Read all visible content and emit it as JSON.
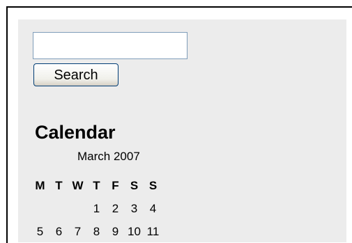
{
  "search": {
    "value": "",
    "button_label": "Search"
  },
  "calendar": {
    "title": "Calendar",
    "caption": "March 2007",
    "weekdays": [
      "M",
      "T",
      "W",
      "T",
      "F",
      "S",
      "S"
    ],
    "weeks": [
      [
        "",
        "",
        "",
        "1",
        "2",
        "3",
        "4"
      ],
      [
        "5",
        "6",
        "7",
        "8",
        "9",
        "10",
        "11"
      ]
    ]
  }
}
